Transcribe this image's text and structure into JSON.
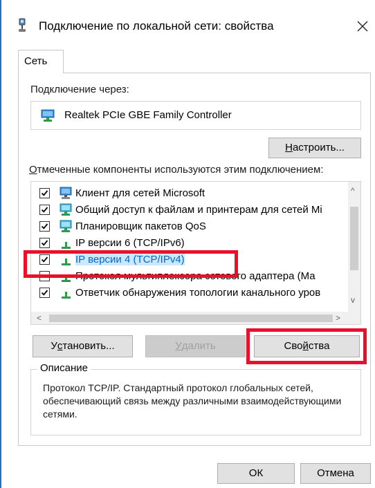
{
  "window": {
    "title": "Подключение по локальной сети: свойства",
    "close_glyph": "✕"
  },
  "tabs": [
    {
      "label": "Сеть",
      "active": true
    }
  ],
  "connect_through": {
    "label": "Подключение через:",
    "adapter_name": "Realtek PCIe GBE Family Controller",
    "adapter_icon": "network-adapter-icon"
  },
  "configure_button": {
    "label_underlined": "Н",
    "label_rest": "астроить..."
  },
  "components": {
    "label_underlined": "О",
    "label_rest": "тмеченные компоненты используются этим подключением:",
    "items": [
      {
        "label": "Клиент для сетей Microsoft",
        "checked": true,
        "icon": "network-client-icon",
        "selected": false
      },
      {
        "label": "Общий доступ к файлам и принтерам для сетей Mi",
        "checked": true,
        "icon": "network-service-icon",
        "selected": false
      },
      {
        "label": "Планировщик пакетов QoS",
        "checked": true,
        "icon": "network-service-icon",
        "selected": false
      },
      {
        "label": "IP версии 6 (TCP/IPv6)",
        "checked": true,
        "icon": "protocol-icon",
        "selected": false
      },
      {
        "label": "IP версии 4 (TCP/IPv4)",
        "checked": true,
        "icon": "protocol-icon",
        "selected": true
      },
      {
        "label": "Протокол мультиплексора сетевого адаптера (Ма",
        "checked": false,
        "icon": "protocol-icon",
        "selected": false
      },
      {
        "label": "Ответчик обнаружения топологии канального уров",
        "checked": true,
        "icon": "protocol-icon",
        "selected": false
      }
    ],
    "scroll_up": "^",
    "scroll_down": "v",
    "scroll_left": "<",
    "scroll_right": ">"
  },
  "action_buttons": {
    "install": {
      "label_pre": "У",
      "label_underlined": "с",
      "label_rest": "тановить..."
    },
    "remove": {
      "label_underlined": "У",
      "label_rest": "далить",
      "disabled": true
    },
    "properties": {
      "label_pre": "Сво",
      "label_underlined": "й",
      "label_rest": "ства"
    }
  },
  "description": {
    "title": "Описание",
    "text": "Протокол TCP/IP. Стандартный протокол глобальных сетей, обеспечивающий связь между различными взаимодействующими сетями."
  },
  "footer": {
    "ok_label": "ОК",
    "cancel_label": "Отмена"
  },
  "colors": {
    "highlight": "#e8102a",
    "selection": "#cce8ff",
    "accent": "#0078d7"
  }
}
